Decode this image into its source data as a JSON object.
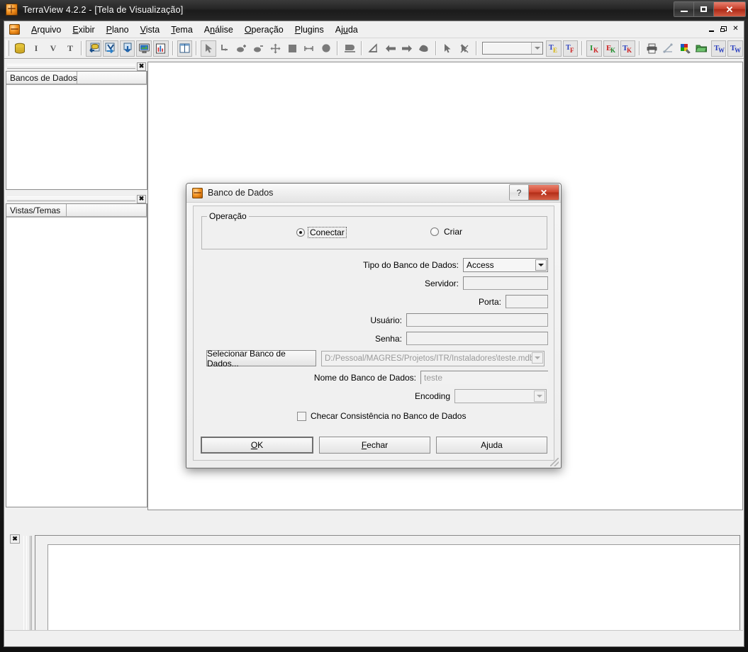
{
  "window": {
    "title": "TerraView 4.2.2 - [Tela de Visualização]",
    "app_icon": "terraview-globe-icon",
    "controls": {
      "minimize": "minimize-icon",
      "maximize": "maximize-icon",
      "close": "close-icon"
    }
  },
  "menubar": {
    "items": [
      {
        "label": "Arquivo",
        "accel": "A"
      },
      {
        "label": "Exibir",
        "accel": "E"
      },
      {
        "label": "Plano",
        "accel": "P"
      },
      {
        "label": "Vista",
        "accel": "V"
      },
      {
        "label": "Tema",
        "accel": "T"
      },
      {
        "label": "Análise",
        "accel": "n"
      },
      {
        "label": "Operação",
        "accel": "O"
      },
      {
        "label": "Plugins",
        "accel": "P"
      },
      {
        "label": "Ajuda",
        "accel": "u"
      }
    ],
    "mdi_controls": {
      "minimize": "mdi-minimize-icon",
      "restore": "mdi-restore-icon",
      "close": "mdi-close-icon"
    }
  },
  "toolbar": {
    "groups": [
      {
        "buttons": [
          {
            "name": "database-icon",
            "title": "Banco de Dados"
          },
          {
            "name": "infolayer-i-icon",
            "title": "I"
          },
          {
            "name": "infolayer-v-icon",
            "title": "V"
          },
          {
            "name": "infolayer-t-icon",
            "title": "T"
          }
        ]
      },
      {
        "buttons": [
          {
            "name": "import-data-icon",
            "title": "Importar Dados"
          },
          {
            "name": "export-data-icon",
            "title": "Exportar Dados"
          },
          {
            "name": "add-theme-icon",
            "title": "Adicionar Tema"
          },
          {
            "name": "screen-view-icon",
            "title": "Tela de Visualização"
          },
          {
            "name": "chart-grid-icon",
            "title": "Gráfico"
          }
        ]
      },
      {
        "buttons": [
          {
            "name": "table-columns-icon",
            "title": "Tabela"
          }
        ]
      },
      {
        "buttons": [
          {
            "name": "pointer-arrow-icon",
            "title": "Apontar",
            "pressed": true
          },
          {
            "name": "zoom-area-icon",
            "title": "Zoom Área"
          },
          {
            "name": "zoom-in-icon",
            "title": "Zoom In"
          },
          {
            "name": "zoom-out-icon",
            "title": "Zoom Out"
          },
          {
            "name": "pan-icon",
            "title": "Pan"
          },
          {
            "name": "zoom-extent-icon",
            "title": "Zoom Total"
          },
          {
            "name": "measure-distance-icon",
            "title": "Medir Distância"
          },
          {
            "name": "zoom-selected-icon",
            "title": "Zoom Selecionado"
          }
        ]
      },
      {
        "buttons": [
          {
            "name": "half-shape-icon",
            "title": "Recortar"
          }
        ]
      },
      {
        "buttons": [
          {
            "name": "draw-line-icon",
            "title": "Desenhar"
          },
          {
            "name": "back-arrow-icon",
            "title": "Anterior"
          },
          {
            "name": "forward-arrow-icon",
            "title": "Próximo"
          },
          {
            "name": "polygon-shape-icon",
            "title": "Polígono"
          }
        ]
      },
      {
        "buttons": [
          {
            "name": "select-pointer-icon",
            "title": "Selecionar"
          },
          {
            "name": "deselect-icon",
            "title": "Desmarcar"
          }
        ]
      },
      {
        "combo": {
          "name": "theme-combo",
          "value": "",
          "placeholder": ""
        }
      },
      {
        "buttons": [
          {
            "name": "te-text-icon",
            "title": "TE"
          },
          {
            "name": "tf-text-icon",
            "title": "TF"
          }
        ]
      },
      {
        "buttons": [
          {
            "name": "ik-icon",
            "title": "IK"
          },
          {
            "name": "ek-icon",
            "title": "EK"
          },
          {
            "name": "tk-icon",
            "title": "TK"
          }
        ]
      },
      {
        "buttons": [
          {
            "name": "print-icon",
            "title": "Imprimir"
          },
          {
            "name": "graph-edit-icon",
            "title": "Editar Gráfico"
          },
          {
            "name": "color-palette-icon",
            "title": "Cores"
          },
          {
            "name": "open-folder-icon",
            "title": "Abrir"
          },
          {
            "name": "tw-icon-1",
            "title": "TW"
          },
          {
            "name": "tw-icon-2",
            "title": "TW"
          }
        ]
      }
    ]
  },
  "panels": {
    "databases": {
      "close_label": "✖",
      "column_header": "Bancos de Dados"
    },
    "views_themes": {
      "close_label": "✖",
      "column_header": "Vistas/Temas"
    },
    "bottom": {
      "close_label": "✖"
    }
  },
  "dialog": {
    "title": "Banco de Dados",
    "icon": "terraview-globe-icon",
    "help_button": "?",
    "close_button": "✕",
    "group": {
      "legend": "Operação",
      "options": [
        {
          "label": "Conectar",
          "selected": true,
          "focused": true
        },
        {
          "label": "Criar",
          "selected": false,
          "focused": false
        }
      ]
    },
    "fields": {
      "db_type": {
        "label": "Tipo do Banco de Dados:",
        "value": "Access"
      },
      "server": {
        "label": "Servidor:",
        "value": ""
      },
      "port": {
        "label": "Porta:",
        "value": ""
      },
      "user": {
        "label": "Usuário:",
        "value": ""
      },
      "password": {
        "label": "Senha:",
        "value": ""
      },
      "select_db_button": "Selecionar Banco de Dados...",
      "db_path": {
        "value": "D:/Pessoal/MAGRES/Projetos/ITR/Instaladores\\teste.mdb"
      },
      "db_name": {
        "label": "Nome do Banco de Dados:",
        "value": "teste"
      },
      "encoding": {
        "label": "Encoding",
        "value": ""
      },
      "check_consistency": {
        "label": "Checar Consistência no Banco de Dados",
        "checked": false
      }
    },
    "buttons": [
      {
        "label": "OK",
        "accel": "O",
        "default": true
      },
      {
        "label": "Fechar",
        "accel": "F",
        "default": false
      },
      {
        "label": "Ajuda",
        "accel": "j",
        "default": false
      }
    ]
  },
  "colors": {
    "window_chrome": "#1a1a1a",
    "face": "#f0f0f0",
    "accent_orange": "#f59521",
    "close_red": "#c8402c",
    "canvas_white": "#ffffff"
  }
}
